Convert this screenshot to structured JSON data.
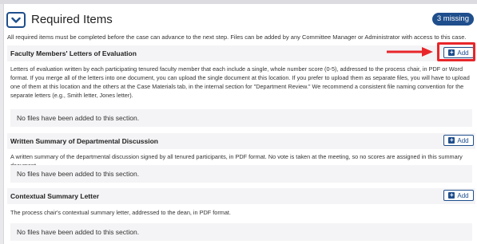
{
  "panel": {
    "title": "Required Items",
    "missing_badge": "3 missing",
    "intro": "All required items must be completed before the case can advance to the next step. Files can be added by any Committee Manager or Administrator with access to this case."
  },
  "sections": [
    {
      "title": "Faculty Members' Letters of Evaluation",
      "add_label": "Add",
      "description": "Letters of evaluation written by each participating tenured faculty member that each include a single, whole number score (0-5), addressed to the process chair, in PDF or Word format. If you merge all of the letters into one document, you can upload the single document at this location. If you prefer to upload them as separate files, you will have to upload one of them at this location and the others at the Case Materials tab, in the internal section for \"Department Review.\" We recommend a consistent file naming convention for the separate letters (e.g., Smith letter, Jones letter).",
      "empty_text": "No files have been added to this section."
    },
    {
      "title": "Written Summary of Departmental Discussion",
      "add_label": "Add",
      "description": "A written summary of the departmental discussion signed by all tenured participants, in PDF format. No vote is taken at the meeting, so no scores are assigned in this summary document.",
      "empty_text": "No files have been added to this section."
    },
    {
      "title": "Contextual Summary Letter",
      "add_label": "Add",
      "description": "The process chair's contextual summary letter, addressed to the dean, in PDF format.",
      "empty_text": "No files have been added to this section."
    }
  ],
  "colors": {
    "accent": "#1f4e8c",
    "highlight": "#e8262a"
  }
}
